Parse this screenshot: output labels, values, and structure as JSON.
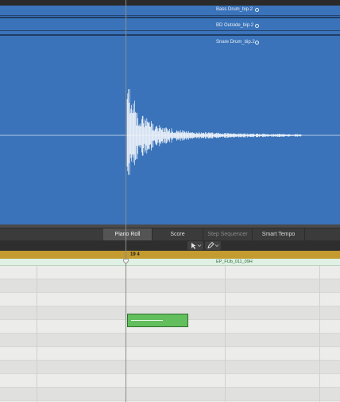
{
  "audio_tracks": [
    {
      "name": "Bass Drum_bip.2"
    },
    {
      "name": "BD Outside_bip.2"
    },
    {
      "name": "Snare Drum_bip.2"
    }
  ],
  "editor_tabs": [
    {
      "label": "Piano Roll",
      "state": "active"
    },
    {
      "label": "Score",
      "state": "normal"
    },
    {
      "label": "Step Sequencer",
      "state": "disabled"
    },
    {
      "label": "Smart Tempo",
      "state": "normal"
    }
  ],
  "toolbar": {
    "pointer_tool_icon": "arrow-pointer-icon",
    "pencil_tool_icon": "pencil-icon",
    "dropdown_icon": "chevron-down-icon"
  },
  "ruler": {
    "position_label": "19 4"
  },
  "region": {
    "name": "EP_FUb_011_09H"
  },
  "colors": {
    "audio_background": "#3a73b9",
    "ruler": "#c39b2f",
    "note": "#63be5e",
    "region_header": "#dff0e4"
  }
}
